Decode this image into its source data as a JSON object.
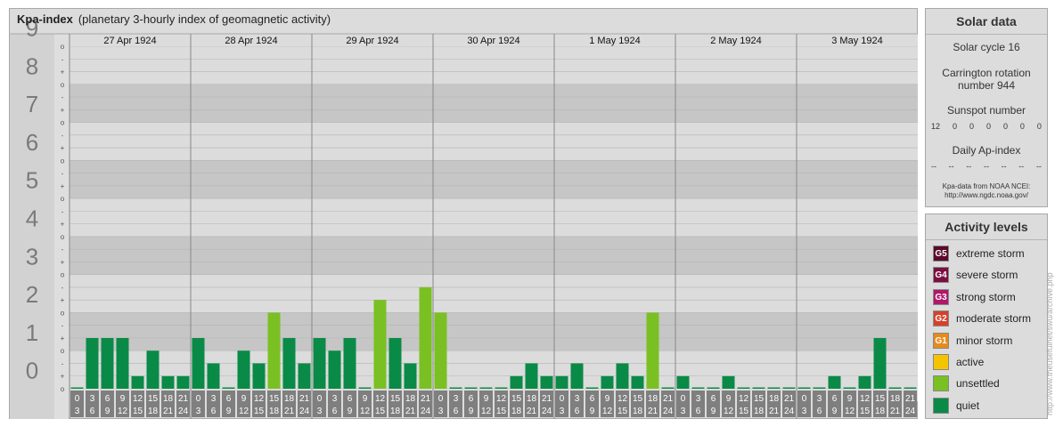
{
  "header": {
    "title": "Kpa-index",
    "subtitle": "(planetary 3-hourly index of geomagnetic activity)"
  },
  "chart_data": {
    "type": "bar",
    "y_ticks": [
      "0",
      "1",
      "2",
      "3",
      "4",
      "5",
      "6",
      "7",
      "8",
      "9"
    ],
    "minor_labels": [
      "o",
      "+",
      "-",
      "o",
      "+",
      "-",
      "o",
      "+",
      "-",
      "o",
      "+",
      "-",
      "o",
      "+",
      "-",
      "o",
      "+",
      "-",
      "o",
      "+",
      "-",
      "o",
      "+",
      "-",
      "o",
      "+",
      "-",
      "o"
    ],
    "ylim": [
      0,
      9
    ],
    "days": [
      "27 Apr 1924",
      "28 Apr 1924",
      "29 Apr 1924",
      "30 Apr 1924",
      "1 May 1924",
      "2 May 1924",
      "3 May 1924"
    ],
    "interval_start": [
      "0",
      "3",
      "6",
      "9",
      "12",
      "15",
      "18",
      "21"
    ],
    "interval_end": [
      "3",
      "6",
      "9",
      "12",
      "15",
      "18",
      "21",
      "24"
    ],
    "values": [
      [
        0,
        1.333,
        1.333,
        1.333,
        0.333,
        1,
        0.333,
        0.333
      ],
      [
        1.333,
        0.667,
        0,
        1,
        0.667,
        2,
        1.333,
        0.667
      ],
      [
        1.333,
        1,
        1.333,
        0,
        2.333,
        1.333,
        0.667,
        2.667
      ],
      [
        2,
        0,
        0,
        0,
        0,
        0.333,
        0.667,
        0.333
      ],
      [
        0.333,
        0.667,
        0,
        0.333,
        0.667,
        0.333,
        2,
        0
      ],
      [
        0.333,
        0,
        0,
        0.333,
        0,
        0,
        0,
        0
      ],
      [
        0,
        0,
        0.333,
        0,
        0.333,
        1.333,
        0,
        0
      ]
    ],
    "colors": {
      "quiet": "#0a8a47",
      "unsettled": "#7ac022",
      "band_dark": "#c6c6c6",
      "band_light": "#dcdcdc"
    }
  },
  "solar": {
    "title": "Solar data",
    "cycle": "Solar cycle 16",
    "carrington_line1": "Carrington rotation",
    "carrington_line2": "number 944",
    "sunspot_title": "Sunspot number",
    "sunspot_values": [
      "12",
      "0",
      "0",
      "0",
      "0",
      "0",
      "0"
    ],
    "ap_title": "Daily Ap-index",
    "ap_values": [
      "--",
      "--",
      "--",
      "--",
      "--",
      "--",
      "--"
    ],
    "credit_line1": "Kpa-data from NOAA NCEI:",
    "credit_line2": "http://www.ngdc.noaa.gov/"
  },
  "levels": {
    "title": "Activity levels",
    "items": [
      {
        "code": "G5",
        "label": "extreme storm",
        "color": "#5a0a2a"
      },
      {
        "code": "G4",
        "label": "severe storm",
        "color": "#7a1040"
      },
      {
        "code": "G3",
        "label": "strong storm",
        "color": "#b0186a"
      },
      {
        "code": "G2",
        "label": "moderate storm",
        "color": "#d6402a"
      },
      {
        "code": "G1",
        "label": "minor storm",
        "color": "#e88a1a"
      },
      {
        "code": "",
        "label": "active",
        "color": "#f5c400"
      },
      {
        "code": "",
        "label": "unsettled",
        "color": "#7ac022"
      },
      {
        "code": "",
        "label": "quiet",
        "color": "#0a8a47"
      }
    ]
  },
  "watermark": "http://www.theusefulnet/swu/archive.php"
}
